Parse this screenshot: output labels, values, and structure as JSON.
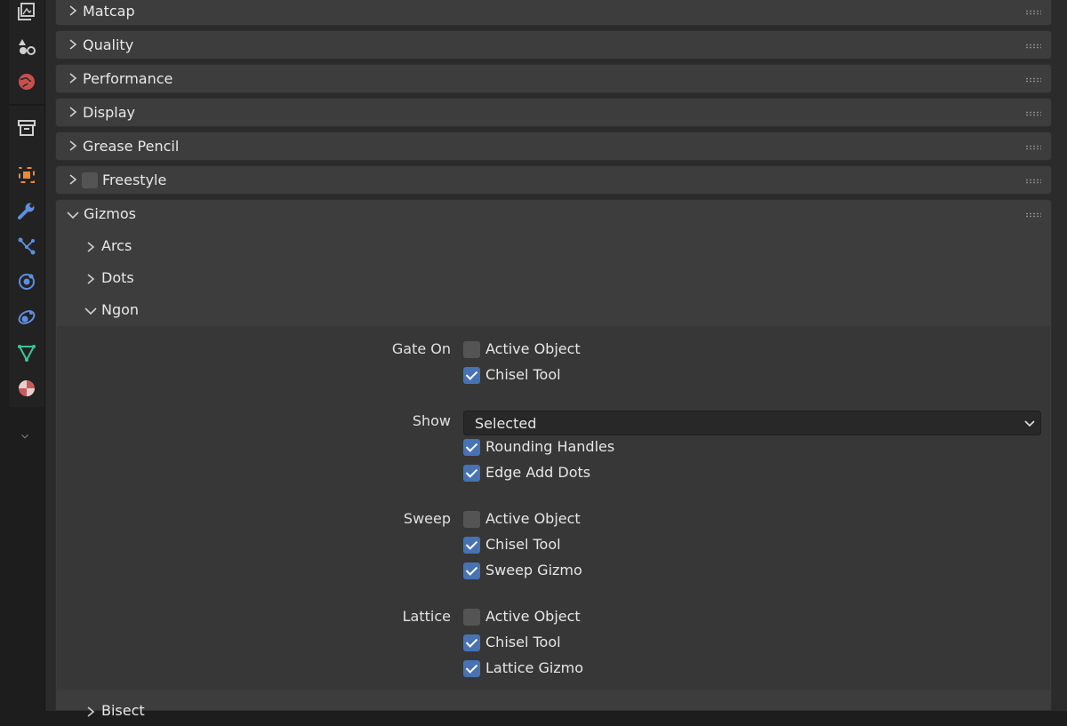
{
  "sidebar": {
    "icons": [
      "view-layer-icon",
      "scene-icon",
      "world-icon",
      "collection-icon",
      "object-icon",
      "modifier-icon",
      "particles-icon",
      "physics-icon",
      "constraints-icon",
      "data-icon",
      "material-icon",
      "expand-icon"
    ]
  },
  "panels": {
    "matcap": "Matcap",
    "quality": "Quality",
    "performance": "Performance",
    "display": "Display",
    "grease_pencil": "Grease Pencil",
    "freestyle": "Freestyle",
    "gizmos": "Gizmos"
  },
  "gizmos": {
    "arcs": "Arcs",
    "dots": "Dots",
    "ngon": "Ngon",
    "bisect": "Bisect"
  },
  "ngon": {
    "gate_on": {
      "label": "Gate On",
      "options": [
        {
          "label": "Active Object",
          "checked": false
        },
        {
          "label": "Chisel Tool",
          "checked": true
        }
      ]
    },
    "show": {
      "label": "Show",
      "selected": "Selected",
      "options": [
        {
          "label": "Rounding Handles",
          "checked": true
        },
        {
          "label": "Edge Add Dots",
          "checked": true
        }
      ]
    },
    "sweep": {
      "label": "Sweep",
      "options": [
        {
          "label": "Active Object",
          "checked": false
        },
        {
          "label": "Chisel Tool",
          "checked": true
        },
        {
          "label": "Sweep Gizmo",
          "checked": true
        }
      ]
    },
    "lattice": {
      "label": "Lattice",
      "options": [
        {
          "label": "Active Object",
          "checked": false
        },
        {
          "label": "Chisel Tool",
          "checked": true
        },
        {
          "label": "Lattice Gizmo",
          "checked": true
        }
      ]
    }
  },
  "colors": {
    "accent": "#4772b3",
    "panel": "#3d3d3d",
    "background": "#2b2b2b"
  }
}
